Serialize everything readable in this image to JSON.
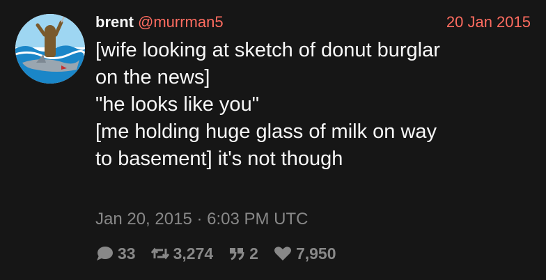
{
  "tweet": {
    "fullname": "brent",
    "username": "@murrman5",
    "date": "20 Jan 2015",
    "lines": [
      "[wife looking at sketch of donut burglar",
      "on the news]",
      "\"he looks like you\"",
      "[me holding huge glass of milk on way",
      "to basement] it's not though"
    ],
    "published": "Jan 20, 2015 · 6:03 PM UTC"
  },
  "stats": {
    "comments": "33",
    "retweets": "3,274",
    "quotes": "2",
    "likes": "7,950"
  },
  "icons": {
    "comment": "comment-icon",
    "retweet": "retweet-icon",
    "quote": "quote-icon",
    "like": "heart-icon"
  },
  "colors": {
    "background": "#161616",
    "text": "#f8f8f8",
    "accent": "#ff6c60",
    "muted": "#888888"
  }
}
